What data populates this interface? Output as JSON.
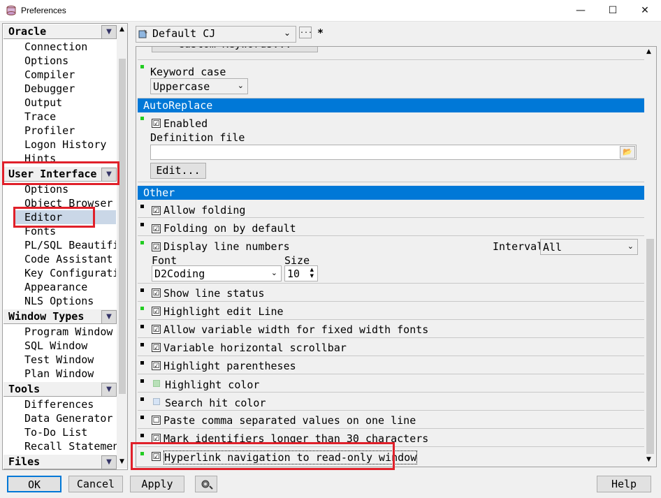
{
  "window": {
    "title": "Preferences",
    "minimize": "—",
    "maximize": "☐",
    "close": "✕"
  },
  "sidebar": {
    "groups": [
      {
        "label": "Oracle",
        "items": [
          "Connection",
          "Options",
          "Compiler",
          "Debugger",
          "Output",
          "Trace",
          "Profiler",
          "Logon History",
          "Hints"
        ]
      },
      {
        "label": "User Interface",
        "items": [
          "Options",
          "Object Browser",
          "Editor",
          "Fonts",
          "PL/SQL Beautifier",
          "Code Assistant",
          "Key Configuration",
          "Appearance",
          "NLS Options"
        ]
      },
      {
        "label": "Window Types",
        "items": [
          "Program Window",
          "SQL Window",
          "Test Window",
          "Plan Window"
        ]
      },
      {
        "label": "Tools",
        "items": [
          "Differences",
          "Data Generator",
          "To-Do List",
          "Recall Statement"
        ]
      },
      {
        "label": "Files",
        "items": []
      }
    ],
    "selected": "Editor"
  },
  "template": {
    "value": "Default CJ",
    "more": "...",
    "modified": "*"
  },
  "editor": {
    "partial_button": "Custom Keywords...",
    "keyword_case_label": "Keyword case",
    "keyword_case_value": "Uppercase",
    "autoreplace_header": "AutoReplace",
    "enabled_label": "Enabled",
    "definition_file_label": "Definition file",
    "definition_file_value": "",
    "edit_button": "Edit...",
    "other_header": "Other",
    "allow_folding": "Allow folding",
    "folding_default": "Folding on by default",
    "display_line_numbers": "Display line numbers",
    "interval_label": "Interval",
    "interval_value": "All",
    "font_label": "Font",
    "font_value": "D2Coding",
    "size_label": "Size",
    "size_value": "10",
    "show_line_status": "Show line status",
    "highlight_edit_line": "Highlight edit Line",
    "allow_variable_width": "Allow variable width for fixed width fonts",
    "variable_hscroll": "Variable horizontal scrollbar",
    "highlight_parentheses": "Highlight parentheses",
    "highlight_color": "Highlight color",
    "search_hit_color": "Search hit color",
    "paste_comma": "Paste comma separated values on one line",
    "mark_identifiers": "Mark identifiers longer than 30 characters",
    "hyperlink_nav": "Hyperlink navigation to read-only window",
    "checked": "☑",
    "unchecked": "☐"
  },
  "buttons": {
    "ok": "OK",
    "cancel": "Cancel",
    "apply": "Apply",
    "help": "Help"
  },
  "colors": {
    "accent": "#0078d7",
    "highlight_box": "#e0202a",
    "marker_green": "#22cc22"
  }
}
